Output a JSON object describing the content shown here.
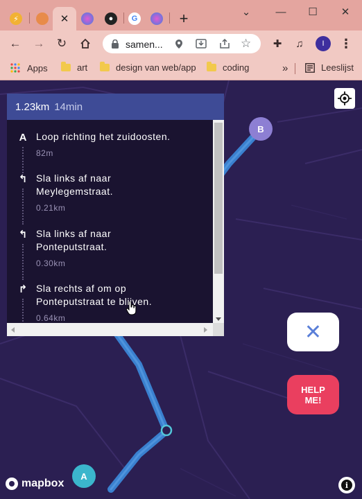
{
  "browser": {
    "tab_close_glyph": "✕",
    "new_tab_glyph": "+",
    "window": {
      "minimize": "⌄",
      "min": "—",
      "max": "☐",
      "close": "✕"
    },
    "address": {
      "text": "samen..."
    },
    "profile_initial": "I",
    "bookmarks": [
      {
        "label": "Apps",
        "icon": "apps-grid-icon"
      },
      {
        "label": "art",
        "icon": "folder-icon"
      },
      {
        "label": "design van web/app",
        "icon": "folder-icon"
      },
      {
        "label": "coding",
        "icon": "folder-icon"
      }
    ],
    "more_bookmarks": "»",
    "reading_list": "Leeslijst"
  },
  "directions": {
    "distance": "1.23km",
    "duration": "14min",
    "steps": [
      {
        "icon": "start-a-icon",
        "glyph": "A",
        "text": "Loop richting het zuidoosten.",
        "distance": "82m"
      },
      {
        "icon": "turn-left-icon",
        "glyph": "↰",
        "text": "Sla links af naar Meylegemstraat.",
        "distance": "0.21km"
      },
      {
        "icon": "turn-left-icon",
        "glyph": "↰",
        "text": "Sla links af naar Ponteputstraat.",
        "distance": "0.30km"
      },
      {
        "icon": "turn-right-icon",
        "glyph": "↱",
        "text": "Sla rechts af om op Ponteputstraat te blijven.",
        "distance": "0.64km"
      }
    ]
  },
  "map": {
    "marker_a": "A",
    "marker_b": "B",
    "close_button": "✕",
    "help_button": "HELP\nME!",
    "attribution": "mapbox",
    "info_glyph": "i",
    "colors": {
      "route": "#3b86d6",
      "background": "#2b1f52",
      "help": "#ea3f5f"
    }
  }
}
